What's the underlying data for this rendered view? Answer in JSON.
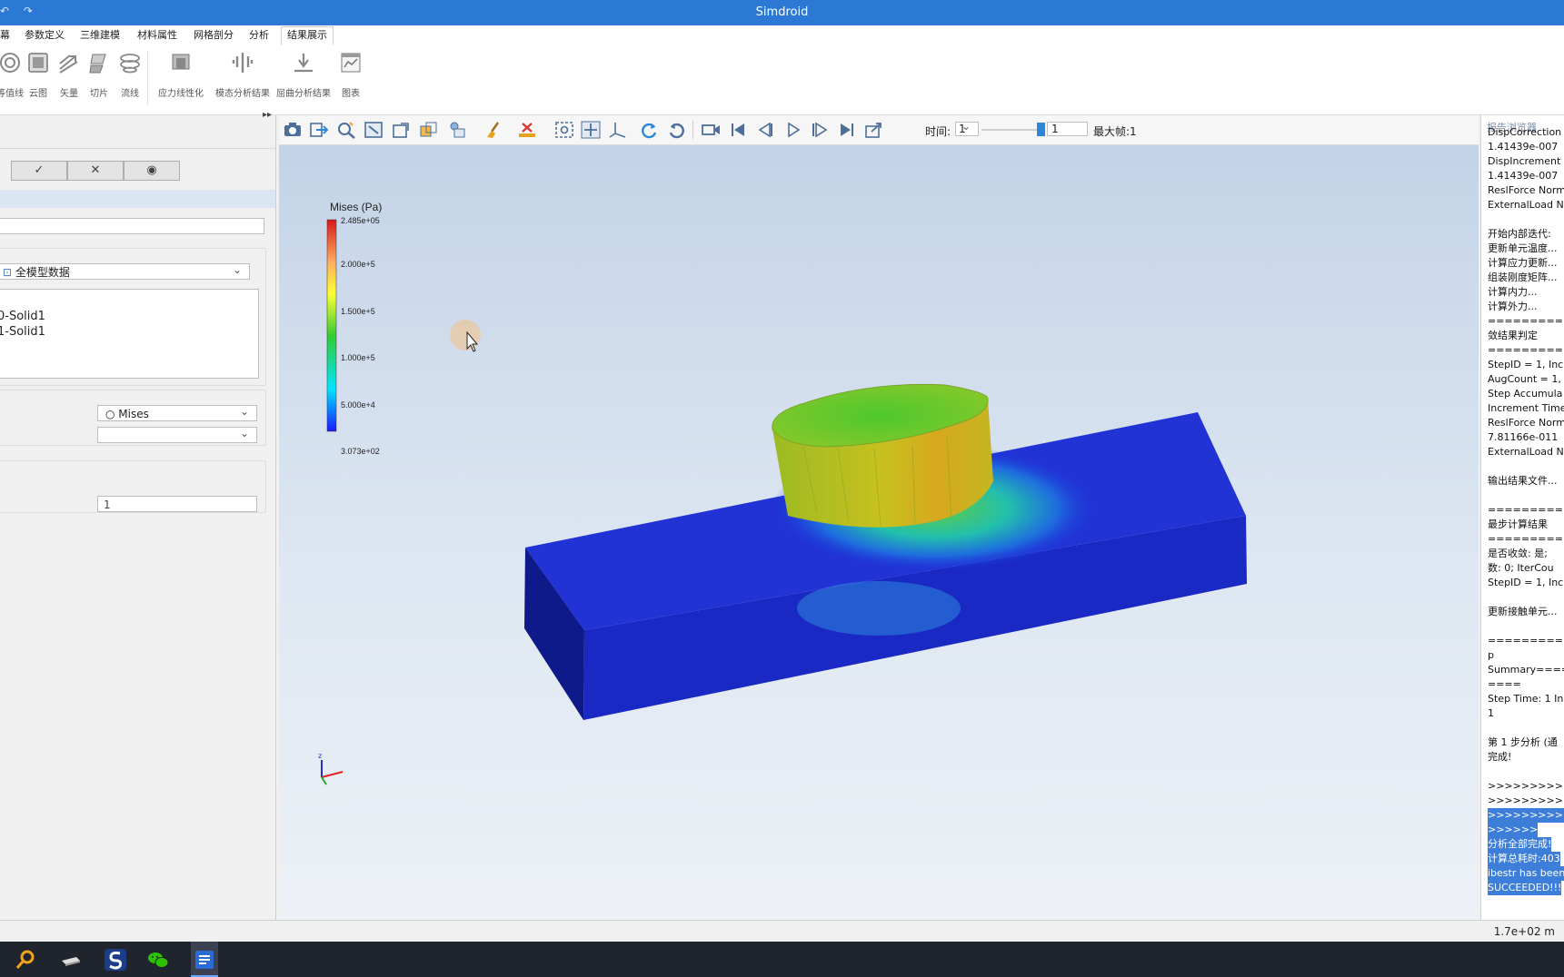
{
  "window": {
    "title": "Simdroid",
    "quick_access": [
      "↶",
      "↷"
    ]
  },
  "menu": {
    "tabs": [
      {
        "label": "幕"
      },
      {
        "label": "参数定义"
      },
      {
        "label": "三维建模"
      },
      {
        "label": "材料属性"
      },
      {
        "label": "网格剖分"
      },
      {
        "label": "分析"
      },
      {
        "label": "结果展示"
      }
    ],
    "active_index": 6
  },
  "ribbon": {
    "buttons": [
      {
        "label": "等值线",
        "icon": "contour-icon"
      },
      {
        "label": "云图",
        "icon": "cloud-map-icon"
      },
      {
        "label": "矢量",
        "icon": "vector-icon"
      },
      {
        "label": "切片",
        "icon": "slice-icon"
      },
      {
        "label": "流线",
        "icon": "streamline-icon"
      },
      {
        "label": "应力线性化",
        "icon": "stress-linearization-icon"
      },
      {
        "label": "模态分析结果",
        "icon": "modal-result-icon"
      },
      {
        "label": "屈曲分析结果",
        "icon": "buckling-result-icon"
      },
      {
        "label": "图表",
        "icon": "chart-icon"
      }
    ]
  },
  "left_panel": {
    "collapse_glyph": "▸▸",
    "buttons": [
      {
        "label": "✓",
        "icon": "confirm-icon"
      },
      {
        "label": "✕",
        "icon": "cancel-icon"
      },
      {
        "label": "◉",
        "icon": "preview-eye-icon"
      }
    ],
    "name_field": "",
    "data_source": "全模型数据",
    "parts": [
      "0-Solid1",
      "1-Solid1"
    ],
    "result_type": "○  Mises",
    "component": "",
    "frame_value": "1"
  },
  "viewport_toolbar": {
    "time_label": "时间:",
    "time_value": "1",
    "frame_value": "1",
    "max_frame": "最大帧:1",
    "slider_fraction": 1.0
  },
  "legend": {
    "title": "Mises (Pa)",
    "ticks": [
      "2.485e+05",
      "2.000e+5",
      "1.500e+5",
      "1.000e+5",
      "5.000e+4",
      "3.073e+02"
    ],
    "colors": [
      "#d7191c",
      "#fdae61",
      "#ffff33",
      "#33cc33",
      "#00e5ff",
      "#1a1aff"
    ]
  },
  "report_browser": {
    "title": "报告浏览器",
    "lines": [
      "DispCorrection",
      "1.41439e-007",
      "DispIncrement",
      "1.41439e-007",
      "ReslForce Norm",
      "ExternalLoad N",
      "",
      "开始内部迭代:",
      "更新单元温度...",
      "计算应力更新...",
      "组装刚度矩阵...",
      "计算内力...",
      "计算外力...",
      "==========",
      "敛结果判定",
      "==========",
      "StepID = 1, Inc",
      "AugCount = 1,",
      "Step Accumula",
      "Increment Time",
      "ReslForce Norm",
      "7.81166e-011",
      "ExternalLoad N",
      "",
      "输出结果文件...",
      "",
      "==========",
      "最步计算结果",
      "==========",
      "是否收敛:  是; ",
      "数:  0; IterCou",
      "StepID = 1, Inc",
      "",
      "更新接触单元...",
      "",
      "==========",
      "p",
      "Summary====",
      "====",
      "Step Time: 1 In",
      "1",
      "",
      "第 1 步分析 (通",
      "完成!",
      "",
      ">>>>>>>>>>",
      ">>>>>>>>>>",
      ">>>>>>>>>>",
      ">>>>>>",
      "分析全部完成!",
      "计算总耗时:403",
      "ibestr has been",
      "SUCCEEDED!!!"
    ],
    "selected_from": 47
  },
  "status": {
    "coordinate": "1.7e+02 m"
  }
}
